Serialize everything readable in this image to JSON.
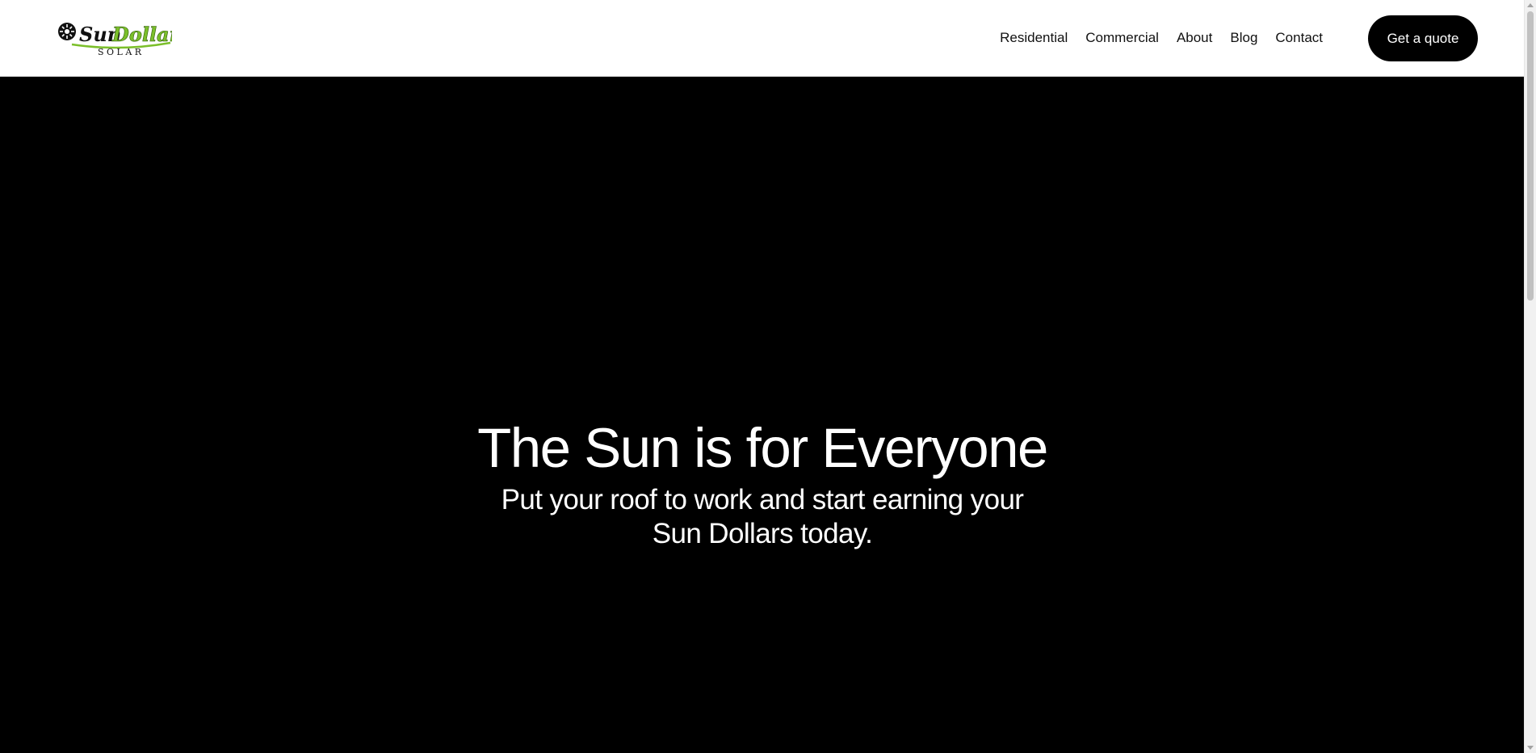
{
  "brand": {
    "logo_word_1": "Sun",
    "logo_word_2": "Dollar",
    "logo_sub": "SOLAR",
    "accent_color": "#7bbf2a"
  },
  "nav": {
    "items": [
      {
        "label": "Residential"
      },
      {
        "label": "Commercial"
      },
      {
        "label": "About"
      },
      {
        "label": "Blog"
      },
      {
        "label": "Contact"
      }
    ],
    "cta_label": "Get a quote"
  },
  "hero": {
    "title": "The Sun is for Everyone",
    "subtitle_line_1": "Put your roof to work and start earning your",
    "subtitle_line_2": "Sun Dollars today."
  }
}
